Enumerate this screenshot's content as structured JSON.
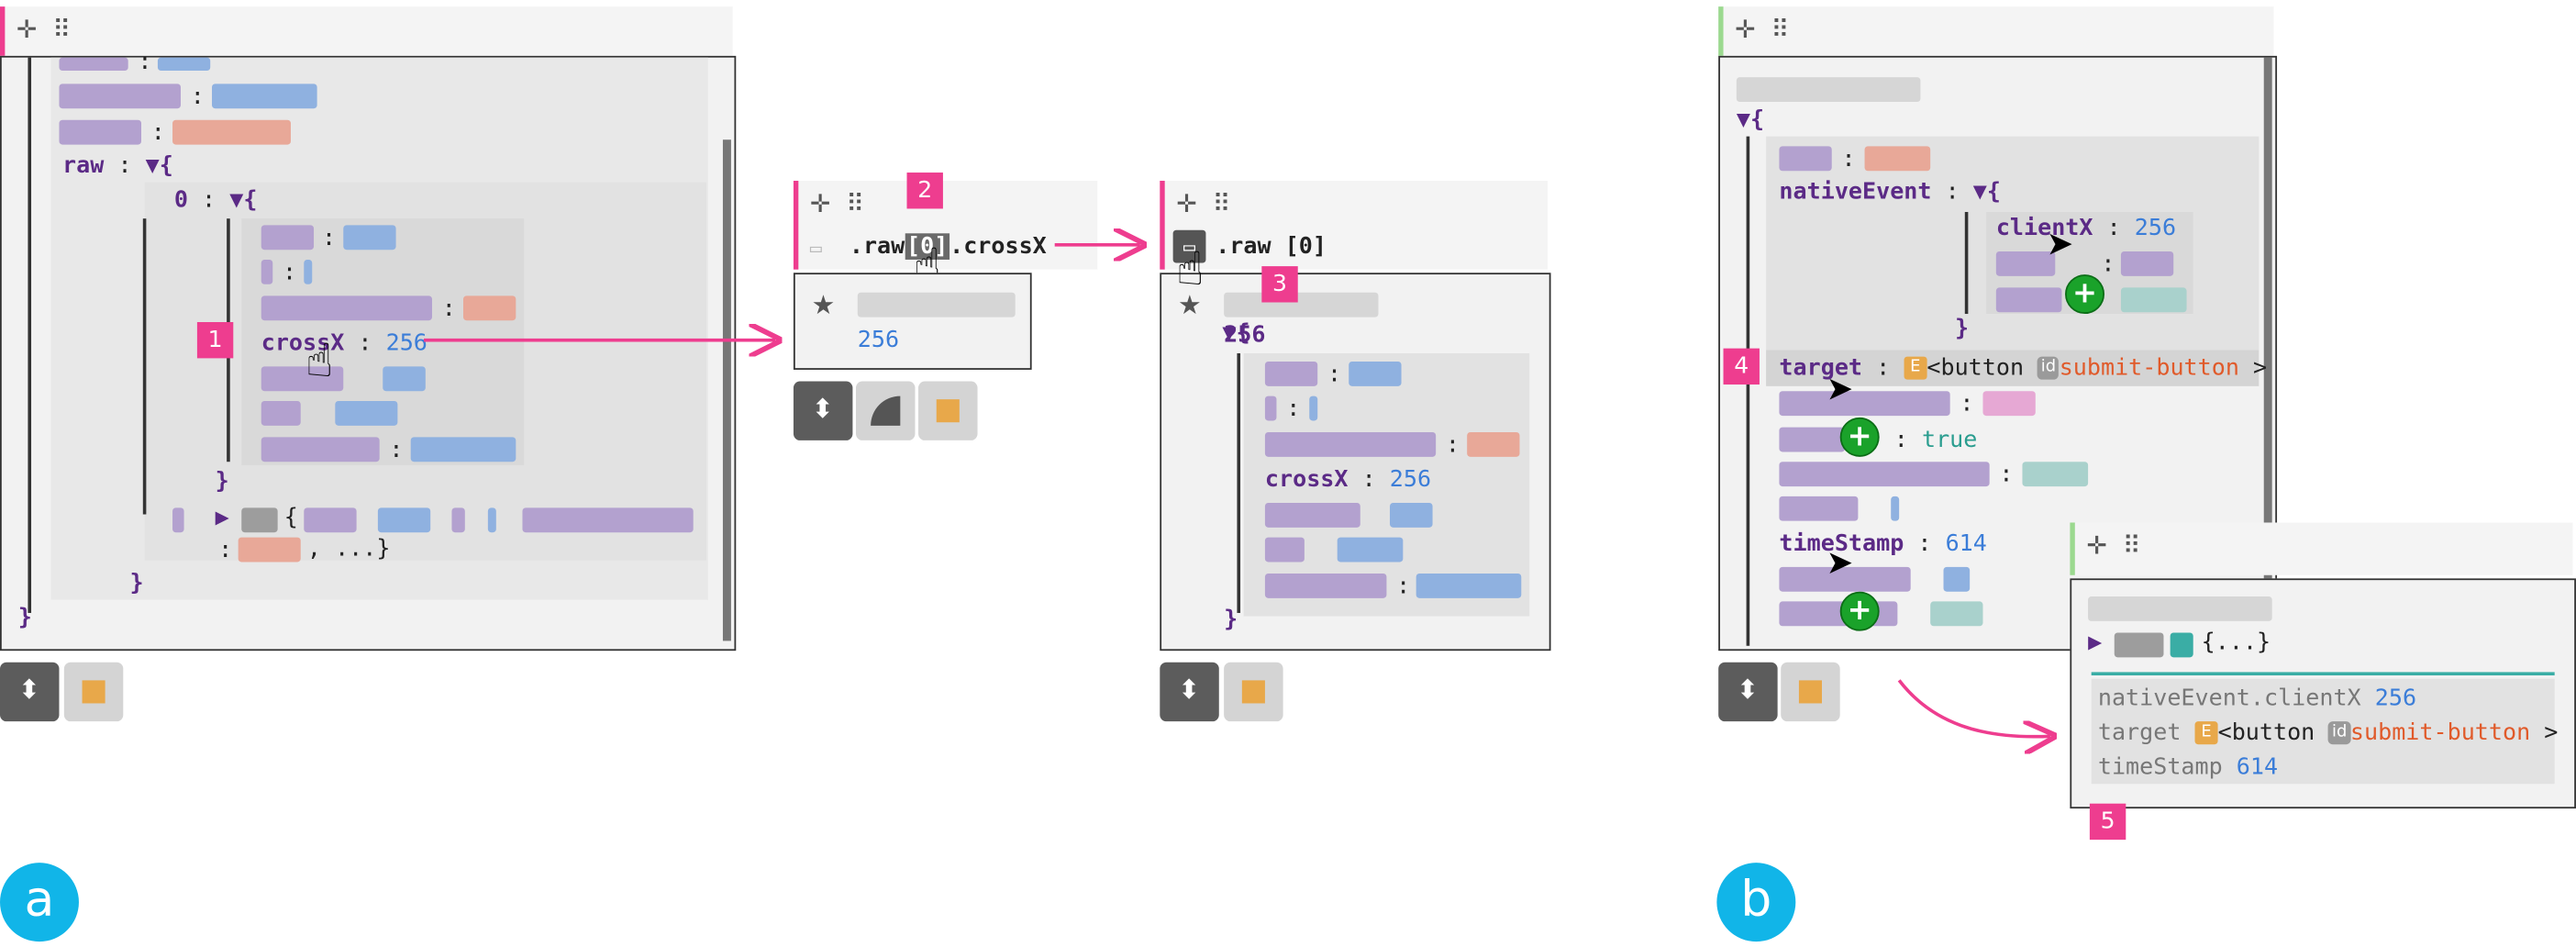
{
  "panel_a": {
    "raw_key": "raw",
    "open_brace": "▼{",
    "index_key": "0",
    "crossx_key": "crossX",
    "crossx_value": "256",
    "close_brace": "}",
    "collapsed_tail": ", ...}"
  },
  "panel_2": {
    "path_prefix": ".raw",
    "path_index": "[0]",
    "path_suffix": ".crossX",
    "value": "256"
  },
  "panel_3": {
    "path": ".raw [0]",
    "crossx_key": "crossX",
    "crossx_value": "256"
  },
  "panel_b": {
    "native_key": "nativeEvent",
    "clientx_key": "clientX",
    "clientx_value": "256",
    "target_key": "target",
    "target_tag_letter": "E",
    "target_element": "<button",
    "target_id_label": "id",
    "target_id_value": "submit-button",
    "target_close": ">",
    "true_value": "true",
    "timestamp_key": "timeStamp",
    "timestamp_value": "614"
  },
  "panel_5": {
    "collapsed": "{...}",
    "row1_key": "nativeEvent.clientX",
    "row1_value": "256",
    "row2_key": "target",
    "row2_tag_letter": "E",
    "row2_element": "<button",
    "row2_id_label": "id",
    "row2_id_value": "submit-button",
    "row2_close": ">",
    "row3_key": "timeStamp",
    "row3_value": "614"
  },
  "badges": {
    "b1": "1",
    "b2": "2",
    "b3": "3",
    "b4": "4",
    "b5": "5"
  },
  "labels": {
    "a": "a",
    "b": "b"
  },
  "colors": {
    "accent_pink": "#ee3d8f",
    "accent_green": "#9bd98f",
    "label_cyan": "#11b5e8",
    "key_purple": "#5b2a86",
    "value_blue": "#3b7dd8",
    "string_orange": "#e05a2a"
  },
  "icons": [
    "move-icon",
    "grip-icon",
    "star-icon",
    "sort-icon",
    "pie-icon",
    "color-square-icon",
    "detach-icon",
    "hand-pointer-icon",
    "arrow-pointer-icon",
    "add-icon"
  ]
}
